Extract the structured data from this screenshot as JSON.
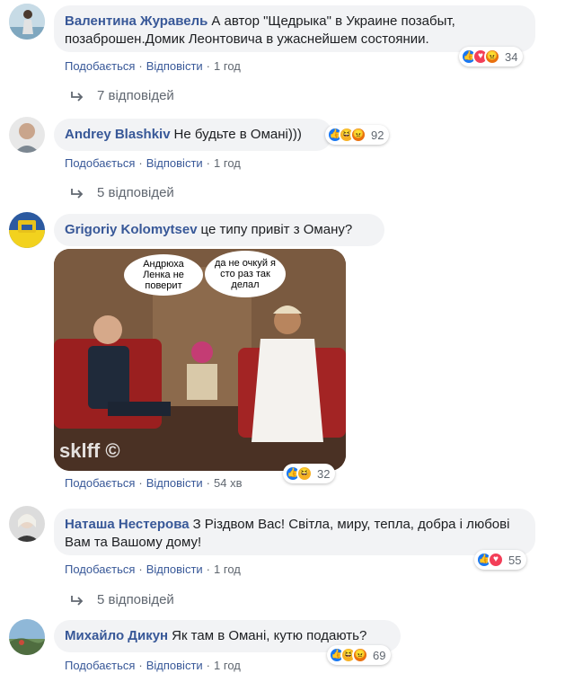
{
  "comments": [
    {
      "author": "Валентина Журавель",
      "text": "А автор \"Щедрыка\" в Украине позабыт, позаброшен.Домик Леонтовича в ужаснейшем состоянии.",
      "like": "Подобається",
      "reply": "Відповісти",
      "time": "1 год",
      "reactions_count": "34",
      "reaction_icons": [
        "like",
        "love",
        "angry"
      ],
      "replies_label": "7 відповідей"
    },
    {
      "author": "Andrey Blashkiv",
      "text": "Не будьте в Омані)))",
      "like": "Подобається",
      "reply": "Відповісти",
      "time": "1 год",
      "reactions_count": "92",
      "reaction_icons": [
        "like",
        "haha",
        "angry"
      ],
      "replies_label": "5 відповідей"
    },
    {
      "author": "Grigoriy Kolomytsev",
      "text": "це типу привіт з Оману?",
      "like": "Подобається",
      "reply": "Відповісти",
      "time": "54 хв",
      "reactions_count": "32",
      "reaction_icons": [
        "like",
        "haha"
      ],
      "meme": {
        "bubble_left": "Андрюха Ленка не поверит",
        "bubble_right": "да не очкуй я сто раз так делал",
        "watermark": "sklff ©"
      }
    },
    {
      "author": "Наташа Нестерова",
      "text": "З Різдвом Вас! Світла, миру, тепла, добра і любові Вам та Вашому дому!",
      "like": "Подобається",
      "reply": "Відповісти",
      "time": "1 год",
      "reactions_count": "55",
      "reaction_icons": [
        "like",
        "love"
      ],
      "replies_label": "5 відповідей"
    },
    {
      "author": "Михайло Дикун",
      "text": "Як там в Омані, кутю подають?",
      "like": "Подобається",
      "reply": "Відповісти",
      "time": "1 год",
      "reactions_count": "69",
      "reaction_icons": [
        "like",
        "haha",
        "angry"
      ]
    }
  ],
  "colors": {
    "author": "#385898",
    "bubble": "#f2f3f5",
    "meta": "#606770"
  }
}
